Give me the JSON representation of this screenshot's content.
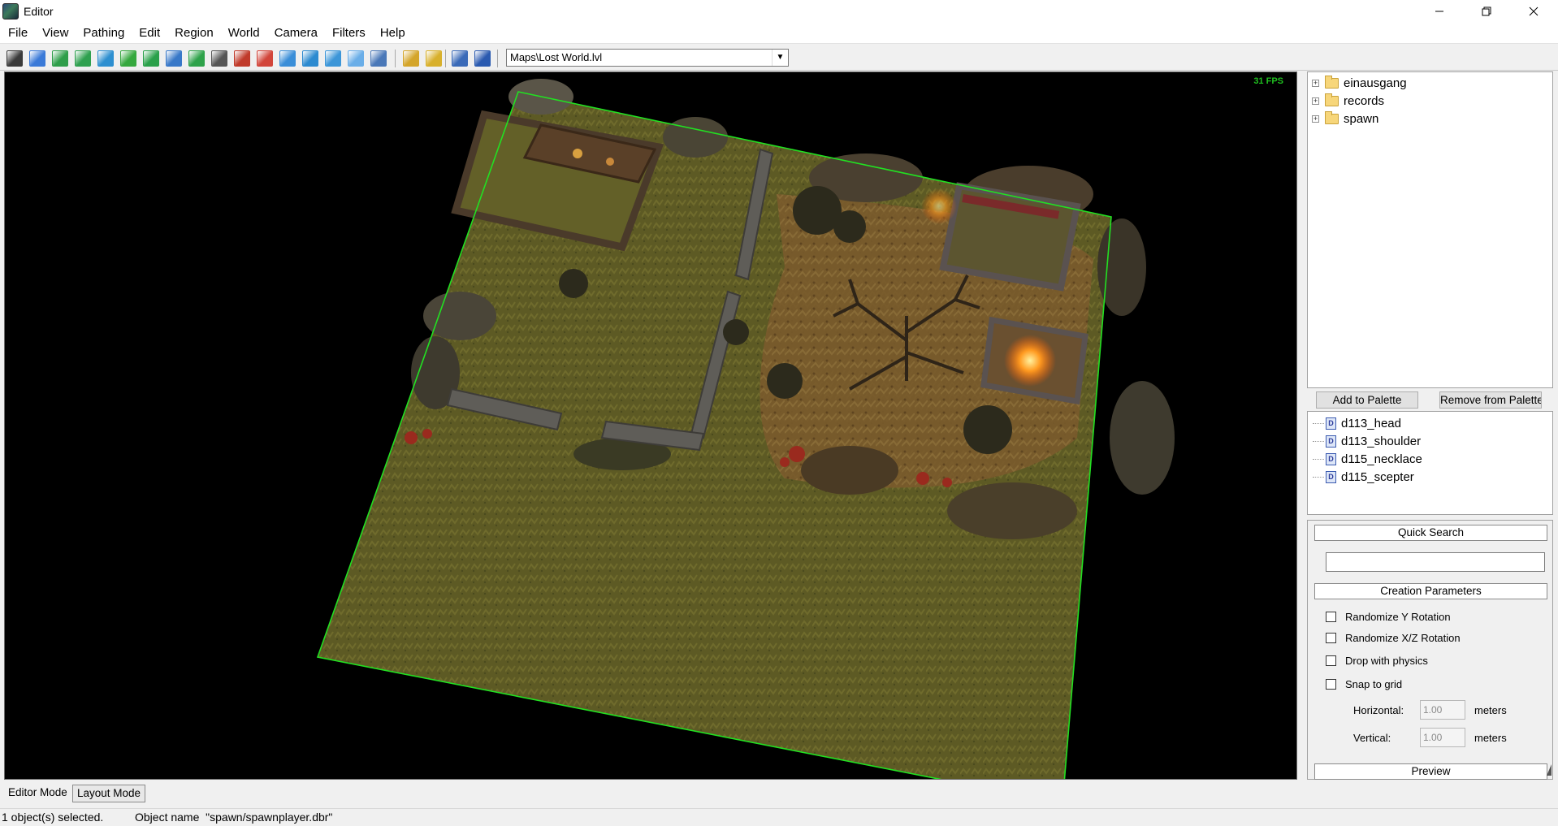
{
  "window": {
    "title": "Editor",
    "app_icon": "editor-app-icon",
    "controls": [
      "minimize-icon",
      "restore-icon",
      "close-icon"
    ]
  },
  "menu": [
    "File",
    "View",
    "Pathing",
    "Edit",
    "Region",
    "World",
    "Camera",
    "Filters",
    "Help"
  ],
  "toolbar": {
    "tools": [
      {
        "icon": "select-tool-icon",
        "color": "#3a3a3a"
      },
      {
        "icon": "move-tool-icon",
        "color": "#3b7ad8"
      },
      {
        "icon": "terrain-raise-icon",
        "color": "#2f9e4a"
      },
      {
        "icon": "terrain-lower-icon",
        "color": "#2fa04f"
      },
      {
        "icon": "terrain-smooth-icon",
        "color": "#2d8fd0"
      },
      {
        "icon": "terrain-flatten-icon",
        "color": "#35a83e"
      },
      {
        "icon": "terrain-paint-icon",
        "color": "#2aa04a"
      },
      {
        "icon": "grid-icon",
        "color": "#3878c8"
      },
      {
        "icon": "path-tool-icon",
        "color": "#2ea24a"
      },
      {
        "icon": "lock-icon",
        "color": "#555555"
      },
      {
        "icon": "brush-icon",
        "color": "#c03a2a"
      },
      {
        "icon": "palette-icon",
        "color": "#d2453a"
      },
      {
        "icon": "water-icon",
        "color": "#3a8ed8"
      },
      {
        "icon": "region-icon",
        "color": "#2c8ad0"
      },
      {
        "icon": "terrain-texture-icon",
        "color": "#3c96d8"
      },
      {
        "icon": "light-icon",
        "color": "#6aaee8"
      },
      {
        "icon": "settings-icon",
        "color": "#4a78b8"
      },
      {
        "icon": "undo-icon",
        "color": "#d4a52a"
      },
      {
        "icon": "redo-icon",
        "color": "#d8b02c"
      },
      {
        "icon": "zoom-icon",
        "color": "#3a6ab8"
      },
      {
        "icon": "view-icon",
        "color": "#2a5ab0"
      }
    ],
    "map_path": "Maps\\Lost World.lvl"
  },
  "viewport": {
    "fps_text": "31 FPS"
  },
  "tree": [
    {
      "label": "einausgang",
      "expander": "+"
    },
    {
      "label": "records",
      "expander": "+"
    },
    {
      "label": "spawn",
      "expander": "+"
    }
  ],
  "palette_buttons": {
    "add": "Add to Palette",
    "remove": "Remove from Palette"
  },
  "palette_items": [
    "d113_head",
    "d113_shoulder",
    "d115_necklace",
    "d115_scepter"
  ],
  "search": {
    "quick_search_title": "Quick Search",
    "quick_search_value": "",
    "creation_title": "Creation Parameters",
    "checks": [
      {
        "label": "Randomize Y Rotation",
        "checked": false
      },
      {
        "label": "Randomize X/Z Rotation",
        "checked": false
      },
      {
        "label": "Drop with physics",
        "checked": false
      },
      {
        "label": "Snap to grid",
        "checked": false
      }
    ],
    "horizontal_label": "Horizontal:",
    "horizontal_value": "1.00",
    "vertical_label": "Vertical:",
    "vertical_value": "1.00",
    "unit": "meters",
    "preview_title": "Preview"
  },
  "modes": {
    "editor": "Editor Mode",
    "layout": "Layout Mode"
  },
  "status": {
    "selected": "1 object(s) selected.",
    "object_name": "Object name  \"spawn/spawnplayer.dbr\""
  }
}
